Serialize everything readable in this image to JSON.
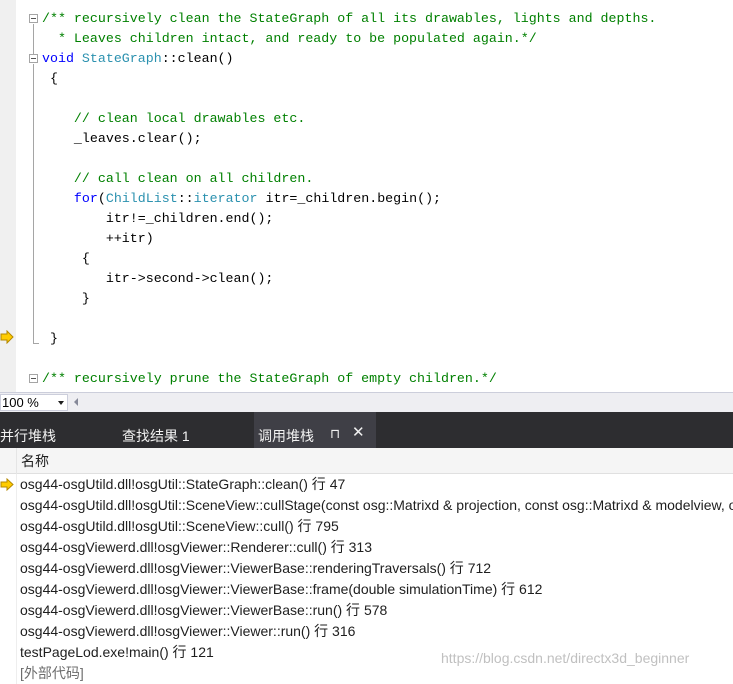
{
  "editor": {
    "lines": [
      {
        "segs": [
          {
            "t": "/** recursively clean the StateGraph of all its drawables, lights and depths.",
            "c": "cm"
          }
        ]
      },
      {
        "segs": [
          {
            "t": "  * Leaves children intact, and ready to be populated again.*/",
            "c": "cm"
          }
        ]
      },
      {
        "segs": [
          {
            "t": "void",
            "c": "kw"
          },
          {
            "t": " ",
            "c": "pl"
          },
          {
            "t": "StateGraph",
            "c": "ty"
          },
          {
            "t": "::clean()",
            "c": "pl"
          }
        ]
      },
      {
        "segs": [
          {
            "t": " {",
            "c": "pl"
          }
        ]
      },
      {
        "segs": []
      },
      {
        "segs": [
          {
            "t": "    // clean local drawables etc.",
            "c": "cm"
          }
        ]
      },
      {
        "segs": [
          {
            "t": "    _leaves.clear();",
            "c": "pl"
          }
        ]
      },
      {
        "segs": []
      },
      {
        "segs": [
          {
            "t": "    // call clean on all children.",
            "c": "cm"
          }
        ]
      },
      {
        "segs": [
          {
            "t": "    ",
            "c": "pl"
          },
          {
            "t": "for",
            "c": "kw"
          },
          {
            "t": "(",
            "c": "pl"
          },
          {
            "t": "ChildList",
            "c": "ty"
          },
          {
            "t": "::",
            "c": "pl"
          },
          {
            "t": "iterator",
            "c": "ty"
          },
          {
            "t": " itr=_children.begin();",
            "c": "pl"
          }
        ]
      },
      {
        "segs": [
          {
            "t": "        itr!=_children.end();",
            "c": "pl"
          }
        ]
      },
      {
        "segs": [
          {
            "t": "        ++itr)",
            "c": "pl"
          }
        ]
      },
      {
        "segs": [
          {
            "t": "     {",
            "c": "pl"
          }
        ]
      },
      {
        "segs": [
          {
            "t": "        itr->second->clean();",
            "c": "pl"
          }
        ]
      },
      {
        "segs": [
          {
            "t": "     }",
            "c": "pl"
          }
        ]
      },
      {
        "segs": []
      },
      {
        "segs": [
          {
            "t": " }",
            "c": "pl"
          }
        ]
      },
      {
        "segs": []
      },
      {
        "segs": [
          {
            "t": "/** recursively prune the StateGraph of empty children.*/",
            "c": "cm"
          }
        ]
      }
    ]
  },
  "zoom": {
    "value": "100 %"
  },
  "tabs": {
    "parallel_stacks": "并行堆栈",
    "find_results": "查找结果 1",
    "call_stack": "调用堆栈",
    "pin_glyph": "⊓",
    "close_glyph": "✕"
  },
  "callstack": {
    "column_name": "名称",
    "rows": [
      "osg44-osgUtild.dll!osgUtil::StateGraph::clean() 行 47",
      "osg44-osgUtild.dll!osgUtil::SceneView::cullStage(const osg::Matrixd & projection, const osg::Matrixd & modelview, osgUtil::CullVisitor * cullVisitor, osgUtil::StateGraph * rendergraph)",
      "osg44-osgUtild.dll!osgUtil::SceneView::cull() 行 795",
      "osg44-osgViewerd.dll!osgViewer::Renderer::cull() 行 313",
      "osg44-osgViewerd.dll!osgViewer::ViewerBase::renderingTraversals() 行 712",
      "osg44-osgViewerd.dll!osgViewer::ViewerBase::frame(double simulationTime) 行 612",
      "osg44-osgViewerd.dll!osgViewer::ViewerBase::run() 行 578",
      "osg44-osgViewerd.dll!osgViewer::Viewer::run() 行 316",
      "testPageLod.exe!main() 行 121"
    ],
    "external_code": "[外部代码]"
  },
  "watermark": "https://blog.csdn.net/directx3d_beginner",
  "colors": {
    "comment": "#008000",
    "keyword": "#0000ff",
    "type": "#2b91af",
    "exec_arrow": "#ffcc00",
    "tab_bar": "#2d2d30"
  },
  "icons": {
    "current_statement": "yellow-arrow-icon",
    "pin": "pin-icon",
    "close": "close-icon",
    "fold": "fold-minus-icon"
  }
}
